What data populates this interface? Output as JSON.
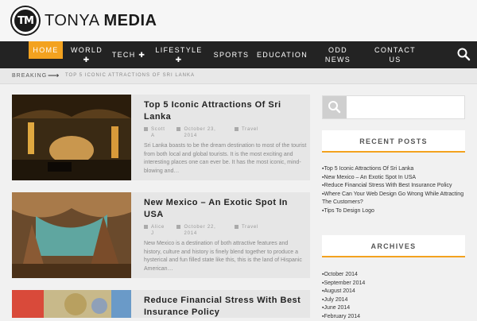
{
  "brand": {
    "logo_initials": "TM",
    "name_light": "TONYA ",
    "name_bold": "MEDIA"
  },
  "nav": [
    {
      "label": "HOME"
    },
    {
      "label": "WORLD ✚"
    },
    {
      "label": "TECH ✚"
    },
    {
      "label": "LIFESTYLE ✚"
    },
    {
      "label": "SPORTS"
    },
    {
      "label": "EDUCATION"
    },
    {
      "label": "ODD\nNEWS"
    },
    {
      "label": "CONTACT\nUS"
    }
  ],
  "breaking": {
    "label": "BREAKING",
    "headline": "TOP 5 ICONIC ATTRACTIONS OF SRI LANKA"
  },
  "posts": [
    {
      "title": "Top 5 Iconic Attractions Of Sri Lanka",
      "author": "Scott A",
      "date": "October 23, 2014",
      "category": "Travel",
      "excerpt": "Sri Lanka boasts to be the dream destination to most of the tourist from both local and global tourists. It is the most exciting and interesting places one can ever be. It has the most iconic, mind-blowing and…"
    },
    {
      "title": "New Mexico – An Exotic Spot In USA",
      "author": "Alice J",
      "date": "October 22, 2014",
      "category": "Travel",
      "excerpt": "New Mexico is a destination of both attractive features and history, culture and history is finely blend together to produce a hysterical and fun filled state like this, this is the land of Hispanic American…"
    },
    {
      "title": "Reduce Financial Stress With Best Insurance Policy"
    }
  ],
  "sidebar": {
    "recent_title": "RECENT POSTS",
    "recent": [
      "Top 5 Iconic Attractions Of Sri Lanka",
      "New Mexico – An Exotic Spot In USA",
      "Reduce Financial Stress With Best Insurance Policy",
      "Where Can Your Web Design Go Wrong While Attracting The Customers?",
      "Tips To Design Logo"
    ],
    "archives_title": "ARCHIVES",
    "archives": [
      "October 2014",
      "September 2014",
      "August 2014",
      "July 2014",
      "June 2014",
      "February 2014"
    ]
  },
  "colors": {
    "accent": "#f3a21f",
    "nav_bg": "#232323"
  }
}
